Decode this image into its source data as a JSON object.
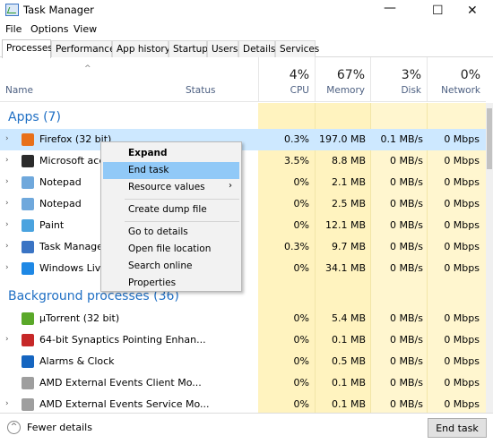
{
  "window": {
    "title": "Task Manager"
  },
  "menu": [
    "File",
    "Options",
    "View"
  ],
  "tabs": [
    "Processes",
    "Performance",
    "App history",
    "Startup",
    "Users",
    "Details",
    "Services"
  ],
  "active_tab": "Processes",
  "columns": {
    "name": "Name",
    "status": "Status",
    "cpu": {
      "pct": "4%",
      "label": "CPU"
    },
    "memory": {
      "pct": "67%",
      "label": "Memory"
    },
    "disk": {
      "pct": "3%",
      "label": "Disk"
    },
    "network": {
      "pct": "0%",
      "label": "Network"
    }
  },
  "groups": {
    "apps": "Apps (7)",
    "background": "Background processes (36)"
  },
  "apps": [
    {
      "name": "Firefox (32 bit)",
      "cpu": "0.3%",
      "mem": "197.0 MB",
      "disk": "0.1 MB/s",
      "net": "0 Mbps",
      "icon": "firefox-icon",
      "color": "#e8701a",
      "selected": true
    },
    {
      "name": "Microsoft acco",
      "cpu": "3.5%",
      "mem": "8.8 MB",
      "disk": "0 MB/s",
      "net": "0 Mbps",
      "icon": "microsoft-account-icon",
      "color": "#2b2b2b"
    },
    {
      "name": "Notepad",
      "cpu": "0%",
      "mem": "2.1 MB",
      "disk": "0 MB/s",
      "net": "0 Mbps",
      "icon": "notepad-icon",
      "color": "#6fa8dc"
    },
    {
      "name": "Notepad",
      "cpu": "0%",
      "mem": "2.5 MB",
      "disk": "0 MB/s",
      "net": "0 Mbps",
      "icon": "notepad-icon",
      "color": "#6fa8dc"
    },
    {
      "name": "Paint",
      "cpu": "0%",
      "mem": "12.1 MB",
      "disk": "0 MB/s",
      "net": "0 Mbps",
      "icon": "paint-icon",
      "color": "#4aa3df"
    },
    {
      "name": "Task Manager",
      "cpu": "0.3%",
      "mem": "9.7 MB",
      "disk": "0 MB/s",
      "net": "0 Mbps",
      "icon": "task-manager-icon",
      "color": "#3a74c4"
    },
    {
      "name": "Windows Live W",
      "cpu": "0%",
      "mem": "34.1 MB",
      "disk": "0 MB/s",
      "net": "0 Mbps",
      "icon": "windows-live-icon",
      "color": "#1e88e5"
    }
  ],
  "background": [
    {
      "name": "µTorrent (32 bit)",
      "cpu": "0%",
      "mem": "5.4 MB",
      "disk": "0 MB/s",
      "net": "0 Mbps",
      "icon": "utorrent-icon",
      "color": "#5aa829",
      "expandable": false
    },
    {
      "name": "64-bit Synaptics Pointing Enhan...",
      "cpu": "0%",
      "mem": "0.1 MB",
      "disk": "0 MB/s",
      "net": "0 Mbps",
      "icon": "synaptics-icon",
      "color": "#c62828",
      "expandable": true
    },
    {
      "name": "Alarms & Clock",
      "cpu": "0%",
      "mem": "0.5 MB",
      "disk": "0 MB/s",
      "net": "0 Mbps",
      "icon": "alarm-clock-icon",
      "color": "#1565c0",
      "expandable": false
    },
    {
      "name": "AMD External Events Client Mo...",
      "cpu": "0%",
      "mem": "0.1 MB",
      "disk": "0 MB/s",
      "net": "0 Mbps",
      "icon": "amd-icon",
      "color": "#9e9e9e",
      "expandable": false
    },
    {
      "name": "AMD External Events Service Mo...",
      "cpu": "0%",
      "mem": "0.1 MB",
      "disk": "0 MB/s",
      "net": "0 Mbps",
      "icon": "amd-icon",
      "color": "#9e9e9e",
      "expandable": true
    }
  ],
  "context_menu": [
    "Expand",
    "End task",
    "Resource values",
    "Create dump file",
    "Go to details",
    "Open file location",
    "Search online",
    "Properties"
  ],
  "footer": {
    "fewer_details": "Fewer details",
    "end_task": "End task"
  }
}
